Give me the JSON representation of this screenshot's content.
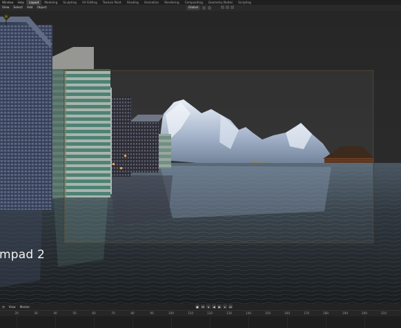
{
  "top_menu": {
    "items": [
      "Window",
      "Help"
    ],
    "workspaces": [
      "Layout",
      "Modeling",
      "Sculpting",
      "UV Editing",
      "Texture Paint",
      "Shading",
      "Animation",
      "Rendering",
      "Compositing",
      "Geometry Nodes",
      "Scripting"
    ],
    "active_workspace": "Layout"
  },
  "header_toolbar": {
    "menus": [
      "View",
      "Select",
      "Add",
      "Object"
    ],
    "transform_orientation": "Global"
  },
  "viewport": {
    "numpad_label": "mpad 2"
  },
  "timeline": {
    "menus": [
      "View",
      "Marker"
    ],
    "ruler": [
      "20",
      "40",
      "60",
      "80",
      "100",
      "120",
      "140",
      "160",
      "180",
      "200",
      "220",
      "240",
      "260"
    ],
    "ruler_left": "",
    "ruler_extra": [
      "0",
      "20",
      "30",
      "40",
      "50",
      "60",
      "70",
      "80",
      "90",
      "100",
      "110",
      "120",
      "130",
      "140",
      "150",
      "160",
      "170",
      "180",
      "190",
      "200",
      "210",
      "220",
      "230",
      "240",
      "250"
    ]
  }
}
